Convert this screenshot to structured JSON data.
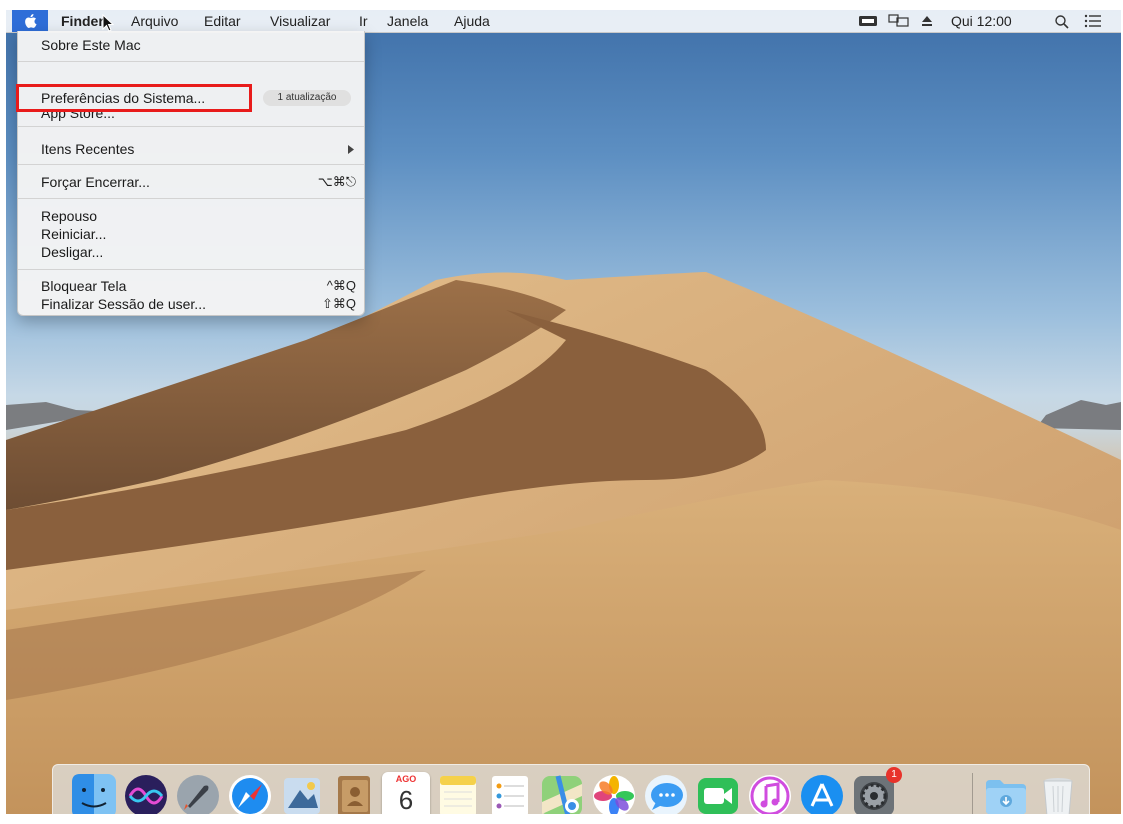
{
  "menubar": {
    "app_name": "Finder",
    "menus": [
      "Arquivo",
      "Editar",
      "Visualizar",
      "Ir",
      "Janela",
      "Ajuda"
    ],
    "clock": "Qui 12:00",
    "status_icons": [
      "keyboard-icon",
      "airplay-display-icon",
      "eject-icon",
      "search-icon",
      "notification-center-icon"
    ]
  },
  "apple_menu": {
    "items": {
      "about": "Sobre Este Mac",
      "system_prefs": "Preferências do Sistema...",
      "update_badge": "1 atualização",
      "app_store": "App Store...",
      "recent_items": "Itens Recentes",
      "force_quit": "Forçar Encerrar...",
      "force_quit_shortcut": "⌥⌘⎋",
      "sleep": "Repouso",
      "restart": "Reiniciar...",
      "shutdown": "Desligar...",
      "lock_screen": "Bloquear Tela",
      "lock_screen_shortcut": "^⌘Q",
      "logout": "Finalizar Sessão de user...",
      "logout_shortcut": "⇧⌘Q"
    }
  },
  "calendar_icon": {
    "month": "AGO",
    "day": "6"
  },
  "system_prefs_badge": "1",
  "dock": {
    "apps": [
      "finder-icon",
      "siri-icon",
      "launchpad-icon",
      "safari-icon",
      "mail-icon",
      "contacts-icon",
      "calendar-icon",
      "notes-icon",
      "reminders-icon",
      "maps-icon",
      "photos-icon",
      "messages-icon",
      "facetime-icon",
      "itunes-icon",
      "app-store-icon",
      "system-preferences-icon",
      "downloads-folder-icon",
      "trash-icon"
    ]
  },
  "colors": {
    "apple_selected": "#2f6ed8",
    "highlight": "#e81b1b"
  }
}
